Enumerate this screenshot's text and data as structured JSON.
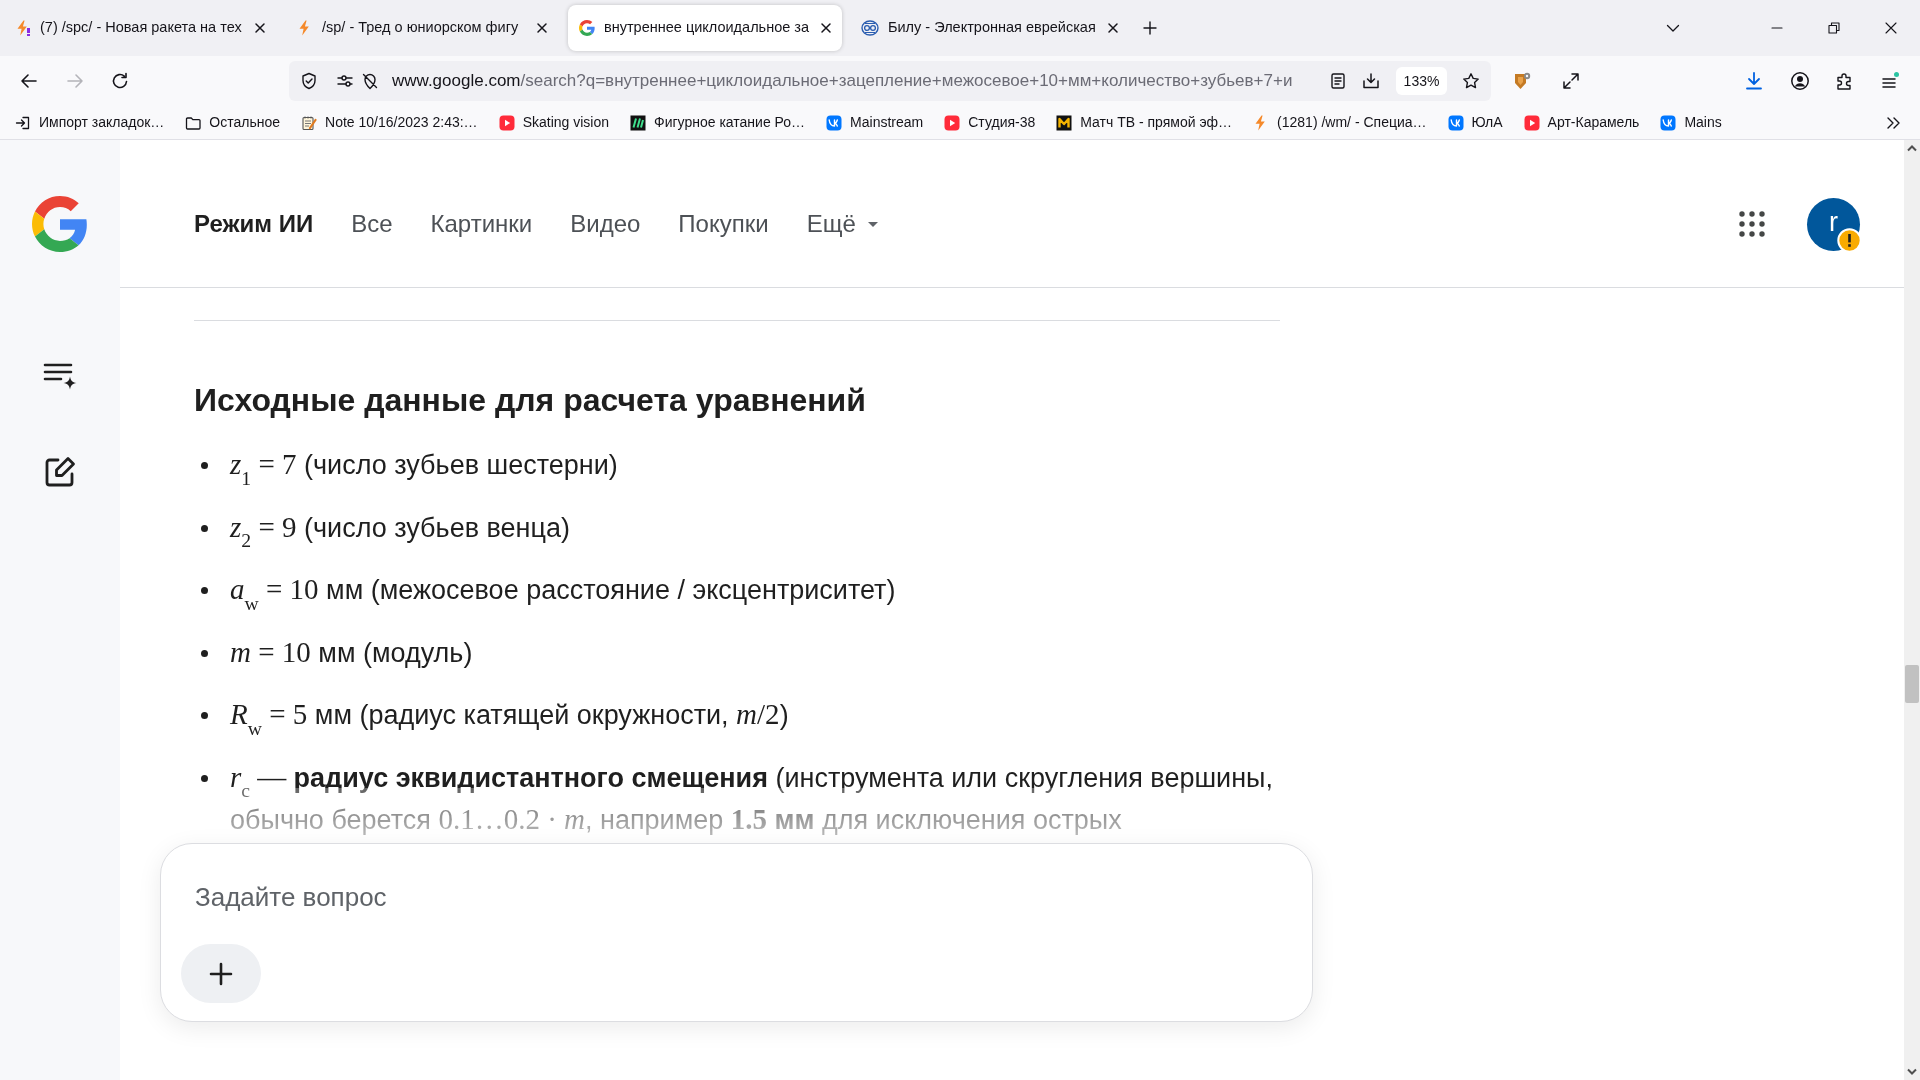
{
  "browser": {
    "tabs": [
      {
        "title": "(7) /spc/ - Новая ракета на тех",
        "selected": false
      },
      {
        "title": "/sp/ - Тред о юниорском фигу",
        "selected": false
      },
      {
        "title": "внутреннее циклоидальное за",
        "selected": true
      },
      {
        "title": "Билу - Электронная еврейская",
        "selected": false
      }
    ],
    "back": {
      "disabled": false
    },
    "forward": {
      "disabled": true
    },
    "address": {
      "host": "www.google.com",
      "path": "/search?q=внутреннее+циклоидальное+зацепление+межосевое+10+мм+количество+зубьев+7+и",
      "zoom": "133%"
    },
    "bookmarks": [
      "Импорт закладок…",
      "Остальное",
      "Note 10/16/2023 2:43:…",
      "Skating vision",
      "Фигурное катание Ро…",
      "Mainstream",
      "Студия-38",
      "Матч ТВ - прямой эф…",
      "(1281) /wm/ - Специа…",
      "ЮлА",
      "Арт-Карамель",
      "Mains"
    ]
  },
  "page": {
    "nav": [
      {
        "label": "Режим ИИ",
        "selected": true,
        "kind": "link"
      },
      {
        "label": "Все",
        "selected": false,
        "kind": "link"
      },
      {
        "label": "Картинки",
        "selected": false,
        "kind": "link"
      },
      {
        "label": "Видео",
        "selected": false,
        "kind": "link"
      },
      {
        "label": "Покупки",
        "selected": false,
        "kind": "link"
      },
      {
        "label": "Ещё",
        "selected": false,
        "kind": "menu"
      }
    ],
    "avatar": "r",
    "heading": "Исходные данные для расчета уравнений",
    "items": [
      {
        "segments": [
          {
            "kind": "math",
            "text": "*z*$_{1}$ = 7"
          },
          {
            "kind": "text",
            "text": " (число зубьев шестерни)"
          }
        ]
      },
      {
        "segments": [
          {
            "kind": "math",
            "text": "*z*$_{2}$ = 9"
          },
          {
            "kind": "text",
            "text": " (число зубьев венца)"
          }
        ]
      },
      {
        "segments": [
          {
            "kind": "math",
            "text": "*a*$_{w}$ = 10"
          },
          {
            "kind": "text",
            "text": " мм (межосевое расстояние / эксцентриситет)"
          }
        ]
      },
      {
        "segments": [
          {
            "kind": "math",
            "text": "*m* = 10"
          },
          {
            "kind": "text",
            "text": " мм (модуль)"
          }
        ]
      },
      {
        "segments": [
          {
            "kind": "math",
            "text": "*R*$_{w}$ = 5"
          },
          {
            "kind": "text",
            "text": " мм (радиус катящей окружности, "
          },
          {
            "kind": "math",
            "text": "*m*/2"
          },
          {
            "kind": "text",
            "text": ")"
          }
        ]
      },
      {
        "segments": [
          {
            "kind": "math",
            "text": "*r*$_{c}$ — "
          },
          {
            "kind": "text",
            "text": "**радиус эквидистантного смещения** (инструмента или скругления вершины, обычно берется "
          },
          {
            "kind": "math",
            "text": "0.1…0.2 · *m*"
          },
          {
            "kind": "text",
            "text": ", например "
          },
          {
            "kind": "math",
            "text": "**1.5**"
          },
          {
            "kind": "text",
            "text": " **мм** для исключения острых"
          }
        ]
      }
    ],
    "composer": {
      "placeholder": "Задайте вопрос"
    }
  }
}
